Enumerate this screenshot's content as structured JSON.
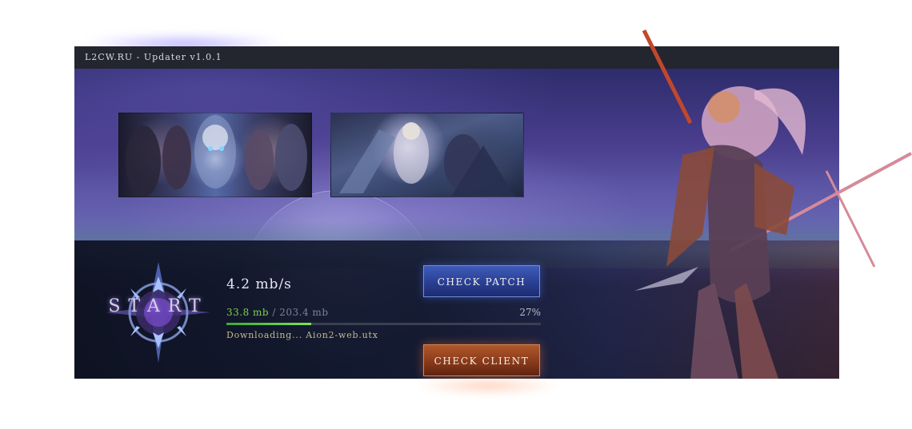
{
  "window": {
    "title": "L2CW.RU - Updater v1.0.1"
  },
  "banners": [
    {
      "name": "heroes-banner"
    },
    {
      "name": "battle-banner"
    }
  ],
  "logo": {
    "text": "START"
  },
  "download": {
    "speed": "4.2 mb/s",
    "downloaded": "33.8 mb",
    "separator": " / ",
    "total": "203.4 mb",
    "percent_label": "27%",
    "progress_fraction": 0.27,
    "status": "Downloading... Aion2-web.utx"
  },
  "buttons": {
    "check_patch": "CHECK PATCH",
    "check_client": "CHECK CLIENT"
  },
  "colors": {
    "accent_blue": "#2a3f94",
    "accent_orange": "#8a3a1a",
    "progress_green": "#7fe34e",
    "titlebar": "#23252f"
  },
  "icons": {
    "logo": "star-compass-emblem",
    "character": "armored-warrior-art"
  }
}
